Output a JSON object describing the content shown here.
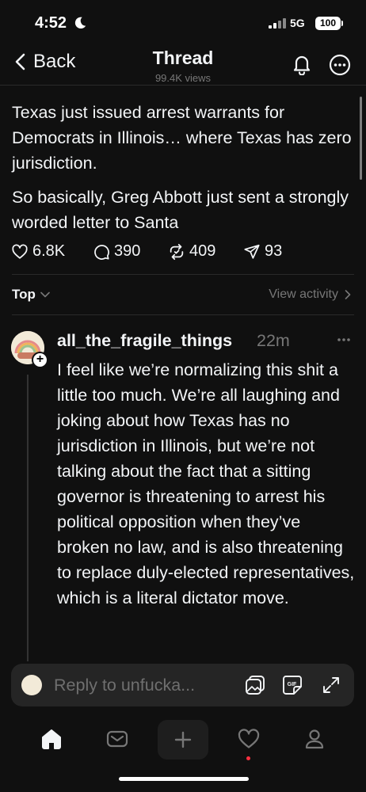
{
  "status_bar": {
    "time": "4:52",
    "network": "5G",
    "battery": "100"
  },
  "header": {
    "back_label": "Back",
    "title": "Thread",
    "subtitle": "99.4K views"
  },
  "post": {
    "paragraphs": [
      "Texas just issued arrest warrants for Democrats in Illinois… where Texas has zero jurisdiction.",
      "So basically, Greg Abbott just sent a strongly worded letter to Santa"
    ],
    "likes": "6.8K",
    "comments": "390",
    "reposts": "409",
    "shares": "93"
  },
  "sort": {
    "label": "Top",
    "view_activity": "View activity"
  },
  "reply": {
    "username": "all_the_fragile_things",
    "time": "22m",
    "text": "I feel like we’re normalizing this shit a little too much. We’re all laughing and joking about how Texas has no jurisdiction in Illinois, but we’re not talking about the fact that a sitting governor is threatening to arrest his political opposition when they’ve broken no law, and is also threatening to replace duly-elected representatives, which is a literal dictator move."
  },
  "composer": {
    "placeholder": "Reply to unfucka...",
    "gif_label": "GIF"
  },
  "icons": {
    "back": "chevron-left-icon",
    "bell": "bell-icon",
    "more": "more-icon",
    "like": "heart-icon",
    "comment": "comment-icon",
    "repost": "repost-icon",
    "share": "send-icon",
    "home": "home-icon",
    "inbox": "inbox-icon",
    "new": "plus-icon",
    "activity": "heart-icon",
    "profile": "profile-icon"
  },
  "colors": {
    "background": "#101010",
    "text": "#f3f5f7",
    "muted": "#777777",
    "notification_dot": "#ff3040"
  }
}
